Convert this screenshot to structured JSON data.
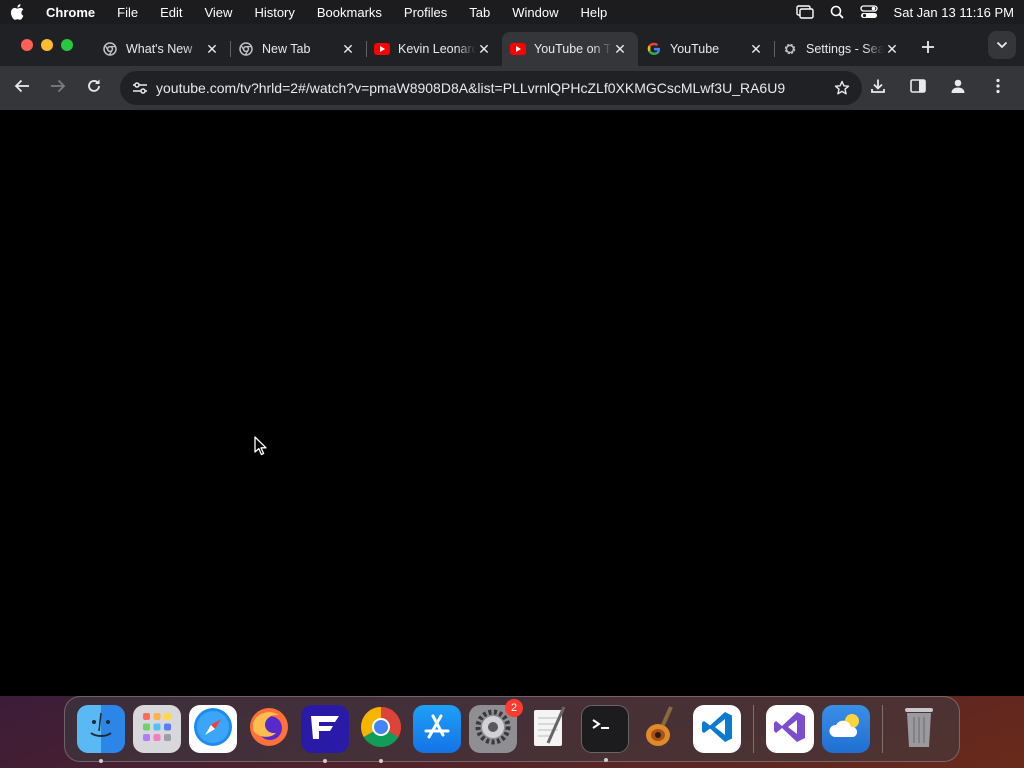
{
  "menubar": {
    "app_name": "Chrome",
    "items": [
      "File",
      "Edit",
      "View",
      "History",
      "Bookmarks",
      "Profiles",
      "Tab",
      "Window",
      "Help"
    ],
    "clock": "Sat Jan 13  11:16 PM"
  },
  "tabs": [
    {
      "title": "What's New",
      "icon": "chrome-icon",
      "active": false
    },
    {
      "title": "New Tab",
      "icon": "chrome-icon",
      "active": false
    },
    {
      "title": "Kevin Leonard",
      "icon": "youtube-icon",
      "active": false
    },
    {
      "title": "YouTube on TV",
      "icon": "youtube-icon",
      "active": true
    },
    {
      "title": "YouTube",
      "icon": "google-icon",
      "active": false
    },
    {
      "title": "Settings - Search",
      "icon": "gear-icon",
      "active": false
    }
  ],
  "address_bar": {
    "url": "youtube.com/tv?hrld=2#/watch?v=pmaW8908D8A&list=PLLvrnlQPHcZLf0XKMGCscMLwf3U_RA6U9"
  },
  "dock": {
    "apps": [
      {
        "name": "Finder",
        "icon": "finder-icon",
        "running": true
      },
      {
        "name": "Launchpad",
        "icon": "launchpad-icon",
        "running": false
      },
      {
        "name": "Safari",
        "icon": "safari-icon",
        "running": false
      },
      {
        "name": "Firefox",
        "icon": "firefox-icon",
        "running": false
      },
      {
        "name": "Fenix",
        "icon": "fenix-icon",
        "running": true
      },
      {
        "name": "Google Chrome",
        "icon": "chrome-icon",
        "running": true
      },
      {
        "name": "App Store",
        "icon": "app-store-icon",
        "running": false
      },
      {
        "name": "System Settings",
        "icon": "system-settings-icon",
        "running": false,
        "badge": "2"
      },
      {
        "name": "TextEdit",
        "icon": "textedit-icon",
        "running": false
      },
      {
        "name": "Terminal",
        "icon": "terminal-icon",
        "running": true
      },
      {
        "name": "GarageBand",
        "icon": "garageband-icon",
        "running": false
      },
      {
        "name": "Visual Studio Code",
        "icon": "vscode-icon",
        "running": false
      },
      {
        "name": "Visual Studio",
        "icon": "visual-studio-icon",
        "running": false
      },
      {
        "name": "Weather",
        "icon": "weather-icon",
        "running": false
      },
      {
        "name": "Trash",
        "icon": "trash-icon",
        "running": false
      }
    ]
  }
}
